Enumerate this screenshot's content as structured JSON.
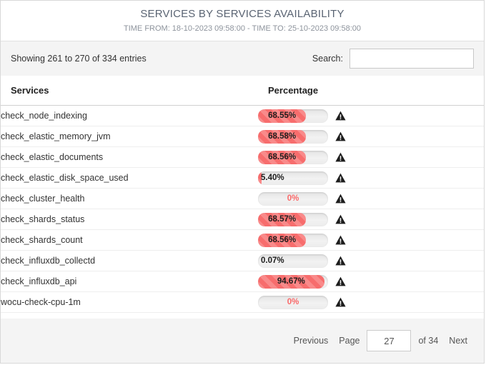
{
  "header": {
    "title": "SERVICES BY SERVICES AVAILABILITY",
    "subtitle": "TIME FROM: 18-10-2023 09:58:00 - TIME TO: 25-10-2023 09:58:00"
  },
  "toolbar": {
    "showing": "Showing 261 to 270 of 334 entries",
    "search_label": "Search:",
    "search_value": "",
    "search_placeholder": ""
  },
  "table": {
    "columns": [
      "Services",
      "Percentage"
    ],
    "rows": [
      {
        "service": "check_node_indexing",
        "label": "68.55%",
        "value": 68.55,
        "warning": "warning-icon"
      },
      {
        "service": "check_elastic_memory_jvm",
        "label": "68.58%",
        "value": 68.58,
        "warning": "warning-icon"
      },
      {
        "service": "check_elastic_documents",
        "label": "68.56%",
        "value": 68.56,
        "warning": "warning-icon"
      },
      {
        "service": "check_elastic_disk_space_used",
        "label": "5.40%",
        "value": 5.4,
        "warning": "warning-icon"
      },
      {
        "service": "check_cluster_health",
        "label": "0%",
        "value": 0,
        "warning": "warning-icon"
      },
      {
        "service": "check_shards_status",
        "label": "68.57%",
        "value": 68.57,
        "warning": "warning-icon"
      },
      {
        "service": "check_shards_count",
        "label": "68.56%",
        "value": 68.56,
        "warning": "warning-icon"
      },
      {
        "service": "check_influxdb_collectd",
        "label": "0.07%",
        "value": 0.07,
        "warning": "warning-icon"
      },
      {
        "service": "check_influxdb_api",
        "label": "94.67%",
        "value": 94.67,
        "warning": "warning-icon"
      },
      {
        "service": "wocu-check-cpu-1m",
        "label": "0%",
        "value": 0,
        "warning": "warning-icon"
      }
    ]
  },
  "footer": {
    "previous_label": "Previous",
    "page_label": "Page",
    "page_value": "27",
    "of_label": "of 34",
    "next_label": "Next"
  },
  "colors": {
    "bar_fill": "#f76d6d",
    "bar_track": "#ececec",
    "zero_text": "#fa6a6a",
    "title": "#5a6473",
    "subtitle": "#8d939c",
    "band": "#f4f4f4"
  },
  "chart_data": {
    "type": "bar",
    "title": "SERVICES BY SERVICES AVAILABILITY",
    "xlabel": "Services",
    "ylabel": "Percentage",
    "ylim": [
      0,
      100
    ],
    "categories": [
      "check_node_indexing",
      "check_elastic_memory_jvm",
      "check_elastic_documents",
      "check_elastic_disk_space_used",
      "check_cluster_health",
      "check_shards_status",
      "check_shards_count",
      "check_influxdb_collectd",
      "check_influxdb_api",
      "wocu-check-cpu-1m"
    ],
    "values": [
      68.55,
      68.58,
      68.56,
      5.4,
      0,
      68.57,
      68.56,
      0.07,
      94.67,
      0
    ],
    "value_labels": [
      "68.55%",
      "68.58%",
      "68.56%",
      "5.40%",
      "0%",
      "68.57%",
      "68.56%",
      "0.07%",
      "94.67%",
      "0%"
    ]
  }
}
